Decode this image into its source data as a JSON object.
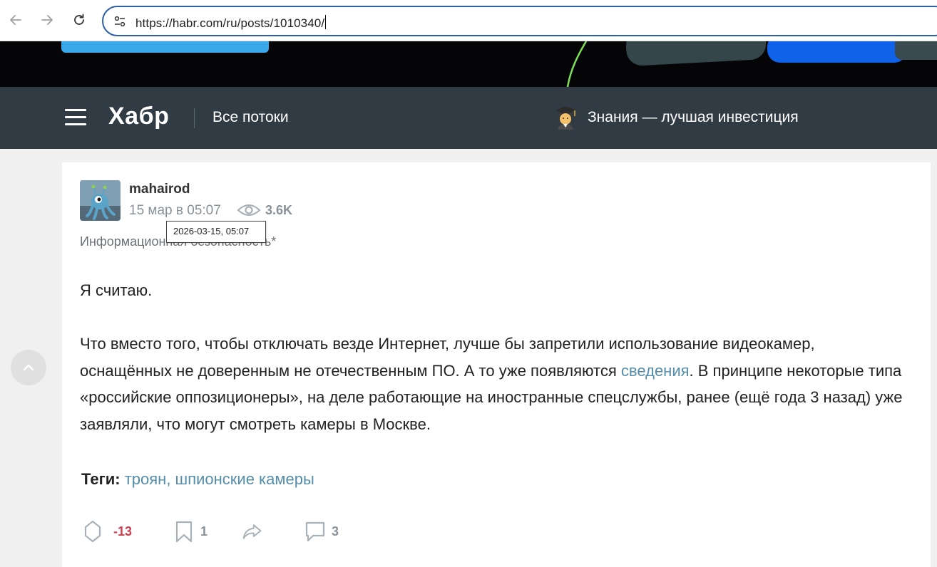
{
  "browser": {
    "url": "https://habr.com/ru/posts/1010340/",
    "icons": [
      "back-arrow-icon",
      "forward-arrow-icon",
      "reload-icon",
      "site-settings-icon"
    ]
  },
  "header": {
    "logo": "Хабр",
    "flows_link": "Все потоки",
    "promo_icon": "student-emoji-icon",
    "promo_text": "Знания — лучшая инвестиция"
  },
  "post": {
    "author": "mahairod",
    "date": "15 мар в 05:07",
    "date_tooltip": "2026-03-15, 05:07",
    "views": "3.6K",
    "hub": "Информационная безопасность*",
    "paragraph_1": "Я считаю.",
    "paragraph_2_part_1": "Что вместо того, чтобы отключать везде Интернет, лучше бы запретили использование видеокамер, оснащённых не доверенным не отечественным ПО. А то уже появляются ",
    "paragraph_2_link": "сведения",
    "paragraph_2_part_2": ". В принципе некоторые типа «российские оппозиционеры», на деле работающие на иностранные спецслужбы, ранее (ещё года 3 назад) уже заявляли, что могут смотреть камеры в Москве.",
    "tags_label": "Теги:",
    "tags": "троян, шпионские камеры"
  },
  "actions": {
    "votes": "-13",
    "bookmarks": "1",
    "comments": "3"
  },
  "colors": {
    "header_bg": "#303b44",
    "link": "#548eaa",
    "negative_votes": "#d04050"
  }
}
